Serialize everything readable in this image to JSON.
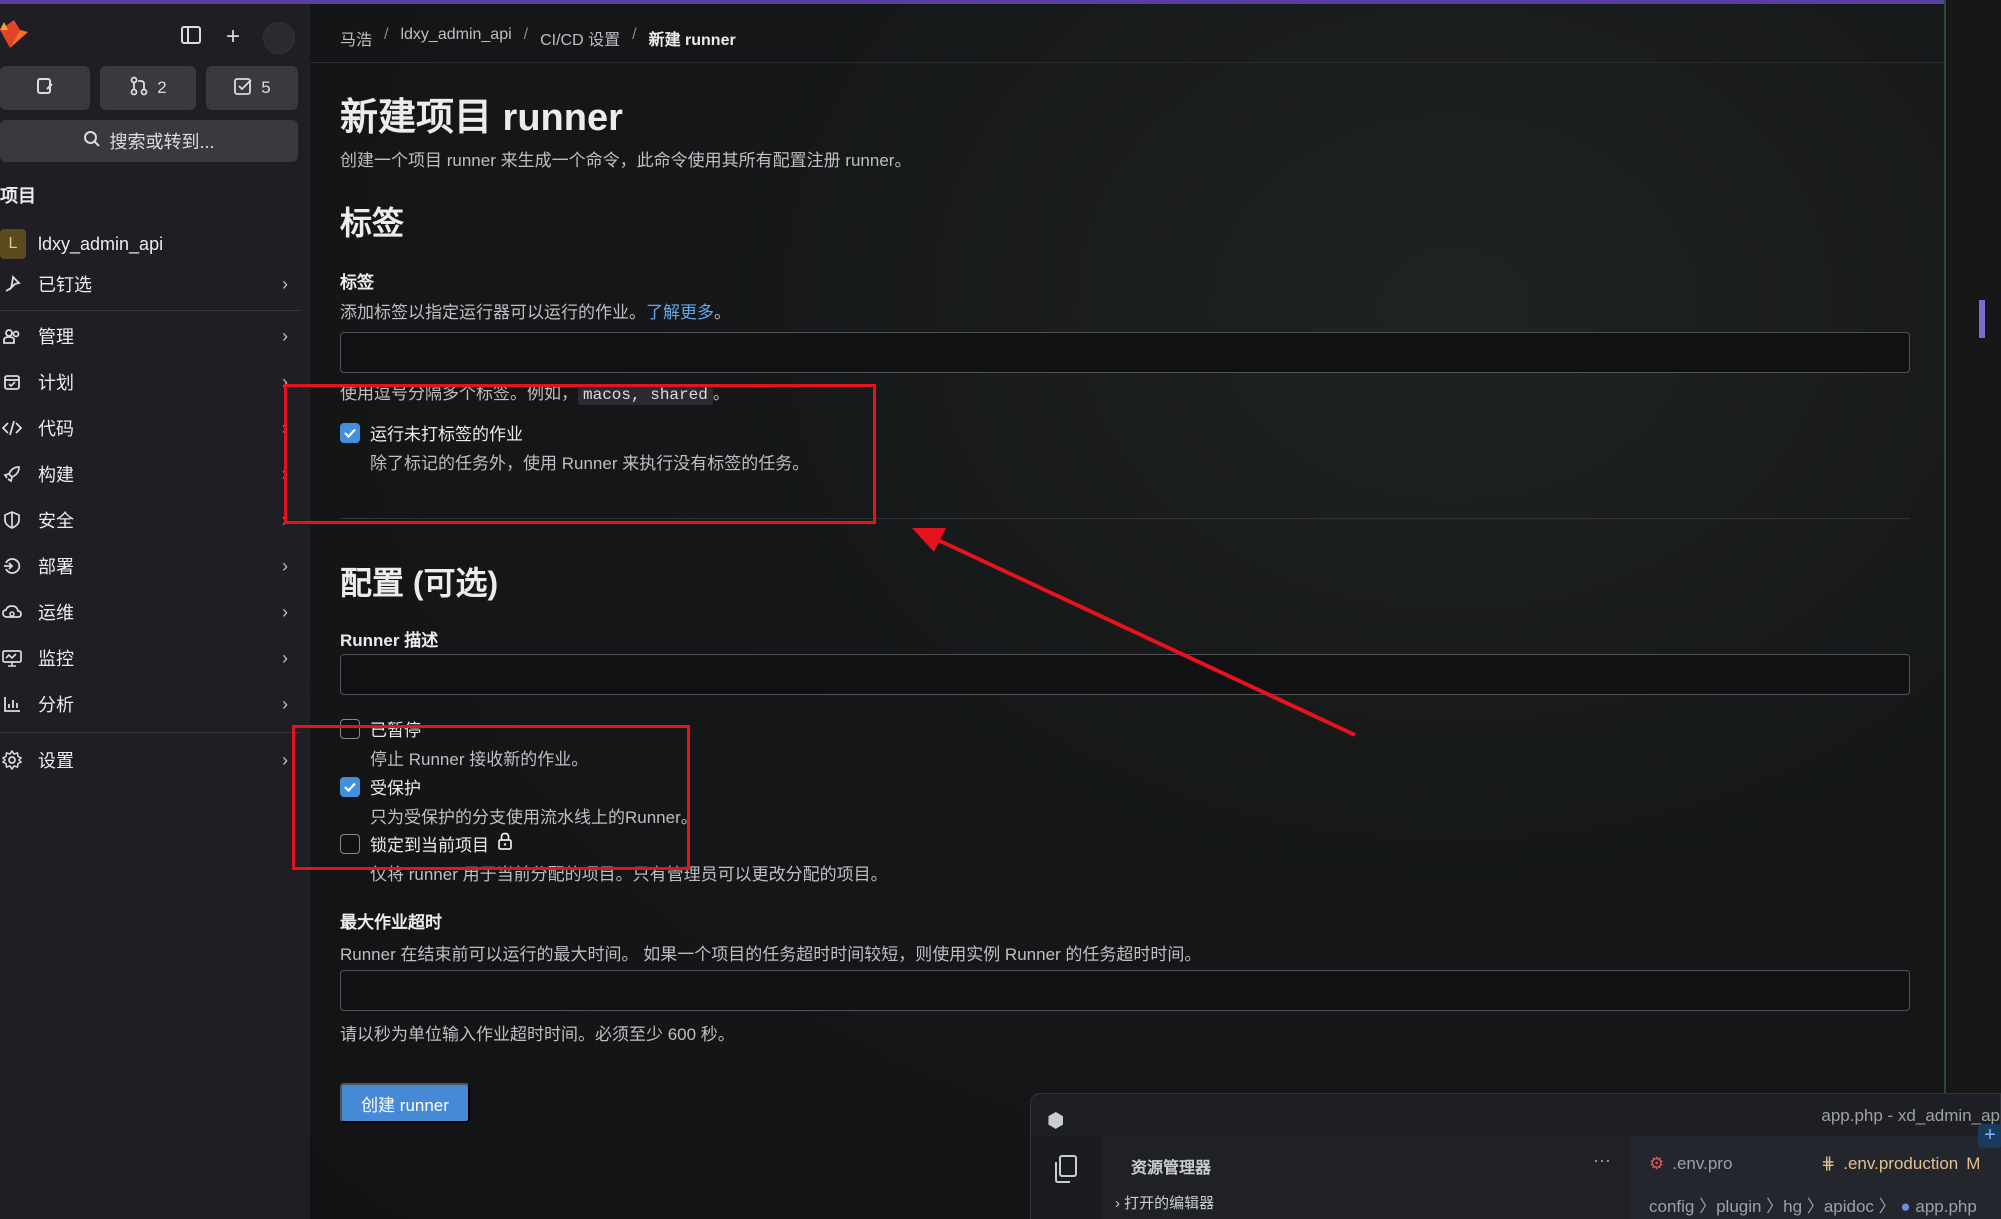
{
  "sidebar": {
    "mr_count": "2",
    "todo_count": "5",
    "search_label": "搜索或转到...",
    "section_title": "项目",
    "project_avatar": "L",
    "project_name": "ldxy_admin_api",
    "nav": [
      {
        "label": "已钉选",
        "icon": "pin-icon"
      },
      {
        "label": "管理",
        "icon": "users-icon"
      },
      {
        "label": "计划",
        "icon": "calendar-icon"
      },
      {
        "label": "代码",
        "icon": "code-icon"
      },
      {
        "label": "构建",
        "icon": "rocket-icon"
      },
      {
        "label": "安全",
        "icon": "shield-icon"
      },
      {
        "label": "部署",
        "icon": "deployments-icon"
      },
      {
        "label": "运维",
        "icon": "cloud-icon"
      },
      {
        "label": "监控",
        "icon": "monitor-icon"
      },
      {
        "label": "分析",
        "icon": "chart-icon"
      },
      {
        "label": "设置",
        "icon": "gear-icon"
      }
    ]
  },
  "breadcrumb": {
    "items": [
      "马浩",
      "ldxy_admin_api",
      "CI/CD 设置",
      "新建 runner"
    ],
    "separator": "/"
  },
  "page": {
    "title": "新建项目 runner",
    "subtitle": "创建一个项目 runner 来生成一个命令，此命令使用其所有配置注册 runner。",
    "tags_section_title": "标签",
    "tags_label": "标签",
    "tags_help": "添加标签以指定运行器可以运行的作业。",
    "tags_help_link": "了解更多",
    "tags_help_end": "。",
    "tags_value": "",
    "tags_hint_prefix": "使用逗号分隔多个标签。例如，",
    "tags_hint_code": "macos, shared",
    "tags_hint_suffix": "。",
    "run_untagged_label": "运行未打标签的作业",
    "run_untagged_help": "除了标记的任务外，使用 Runner 来执行没有标签的任务。",
    "run_untagged_checked": true,
    "config_section_title": "配置 (可选)",
    "description_label": "Runner 描述",
    "description_value": "",
    "paused_label": "已暂停",
    "paused_help": "停止 Runner 接收新的作业。",
    "paused_checked": false,
    "protected_label": "受保护",
    "protected_help": "只为受保护的分支使用流水线上的Runner。",
    "protected_checked": true,
    "locked_label": "锁定到当前项目",
    "locked_help": "仅将 runner 用于当前分配的项目。只有管理员可以更改分配的项目。",
    "locked_checked": false,
    "timeout_label": "最大作业超时",
    "timeout_help": "Runner 在结束前可以运行的最大时间。 如果一个项目的任务超时时间较短，则使用实例 Runner 的任务超时时间。",
    "timeout_value": "",
    "timeout_hint": "请以秒为单位输入作业超时时间。必须至少 600 秒。",
    "submit_label": "创建 runner"
  },
  "vscode": {
    "window_title": "app.php - xd_admin_ap",
    "explorer_title": "资源管理器",
    "open_editors": "打开的编辑器",
    "tab1": ".env.pro",
    "tab2": ".env.production",
    "tab2_status": "M",
    "breadcrumb": "config 〉plugin 〉hg 〉apidoc 〉",
    "breadcrumb_file": "app.php"
  },
  "colors": {
    "accent": "#428fdc",
    "primary_button": "#4689d6",
    "annotation_red": "#e4131c",
    "link": "#63a6e9"
  }
}
